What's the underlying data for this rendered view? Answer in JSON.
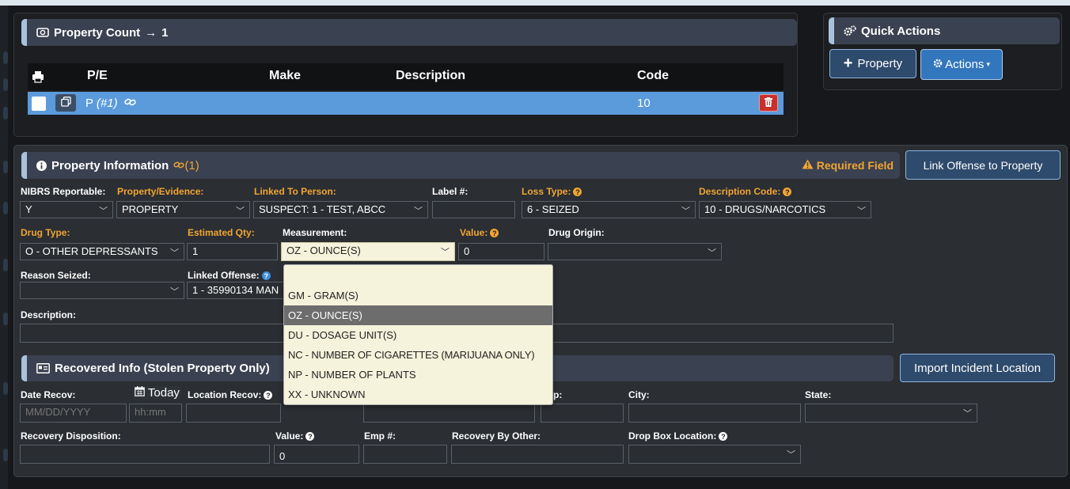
{
  "property_count": {
    "label": "Property Count",
    "arrow": "→",
    "value": "1"
  },
  "table": {
    "headers": {
      "pe": "P/E",
      "make": "Make",
      "description": "Description",
      "code": "Code"
    },
    "rows": [
      {
        "pe": "P",
        "num": "(#1)",
        "make": "",
        "description": "",
        "code": "10"
      }
    ]
  },
  "quick_actions": {
    "title": "Quick Actions",
    "property_button": "Property",
    "actions_button": "Actions"
  },
  "property_info": {
    "title": "Property Information",
    "link_count": "(1)",
    "required_field": "Required Field",
    "link_offense_button": "Link Offense to Property",
    "fields": {
      "nibrs_reportable": {
        "label": "NIBRS Reportable:",
        "value": "Y"
      },
      "property_evidence": {
        "label": "Property/Evidence:",
        "value": "PROPERTY"
      },
      "linked_to_person": {
        "label": "Linked To Person:",
        "value": "SUSPECT: 1 - TEST, ABCC"
      },
      "label_num": {
        "label": "Label #:",
        "value": ""
      },
      "loss_type": {
        "label": "Loss Type:",
        "value": "6 - SEIZED"
      },
      "description_code": {
        "label": "Description Code:",
        "value": "10 - DRUGS/NARCOTICS"
      },
      "drug_type": {
        "label": "Drug Type:",
        "value": "O - OTHER DEPRESSANTS"
      },
      "estimated_qty": {
        "label": "Estimated Qty:",
        "value": "1"
      },
      "measurement": {
        "label": "Measurement:",
        "value": "OZ - OUNCE(S)"
      },
      "value": {
        "label": "Value:",
        "value": "0"
      },
      "drug_origin": {
        "label": "Drug Origin:",
        "value": ""
      },
      "reason_seized": {
        "label": "Reason Seized:",
        "value": ""
      },
      "linked_offense": {
        "label": "Linked Offense:",
        "value": "1 - 35990134 MAN"
      },
      "description": {
        "label": "Description:",
        "value": ""
      }
    },
    "measurement_options": [
      "",
      "GM - GRAM(S)",
      "OZ - OUNCE(S)",
      "DU - DOSAGE UNIT(S)",
      "NC - NUMBER OF CIGARETTES (MARIJUANA ONLY)",
      "NP - NUMBER OF PLANTS",
      "XX - UNKNOWN"
    ]
  },
  "recovered": {
    "title": "Recovered Info (Stolen Property Only)",
    "import_button": "Import Incident Location",
    "fields": {
      "date_recov": {
        "label": "Date Recov:",
        "placeholder_date": "MM/DD/YYYY",
        "placeholder_time": "hh:mm"
      },
      "today": "Today",
      "location_recov": {
        "label": "Location Recov:"
      },
      "zip_label": "p:",
      "city": {
        "label": "City:"
      },
      "state": {
        "label": "State:"
      },
      "recovery_disposition": {
        "label": "Recovery Disposition:"
      },
      "value": {
        "label": "Value:",
        "value": "0"
      },
      "emp_num": {
        "label": "Emp #:"
      },
      "recovery_by_other": {
        "label": "Recovery By Other:"
      },
      "drop_box_location": {
        "label": "Drop Box Location:"
      }
    }
  },
  "colors": {
    "accent": "#a9c2dc",
    "selected_row": "#5b9bdc",
    "required": "#f0a533",
    "primary_button": "#3276bd"
  }
}
